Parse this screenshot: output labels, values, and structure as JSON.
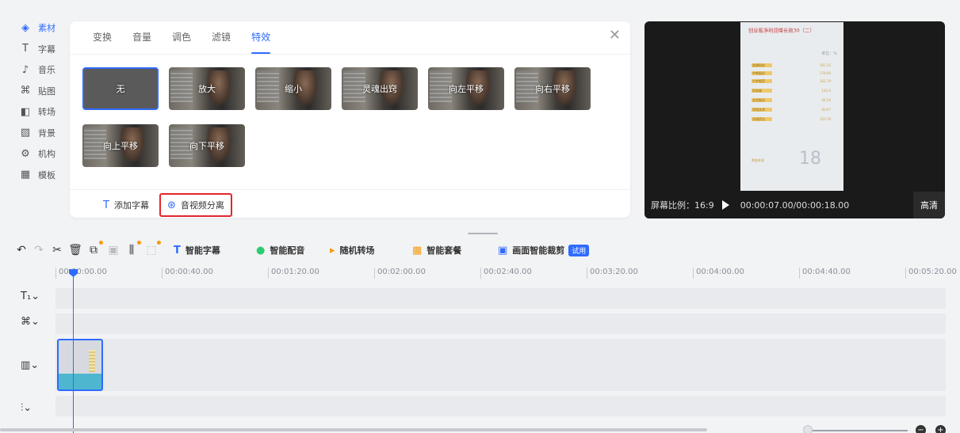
{
  "nav": [
    {
      "icon": "layers-icon",
      "glyph": "◈",
      "label": "素材",
      "active": true
    },
    {
      "icon": "text-icon",
      "glyph": "T",
      "label": "字幕"
    },
    {
      "icon": "music-icon",
      "glyph": "♪",
      "label": "音乐"
    },
    {
      "icon": "sticker-icon",
      "glyph": "⌘",
      "label": "贴图"
    },
    {
      "icon": "transition-icon",
      "glyph": "◧",
      "label": "转场"
    },
    {
      "icon": "background-icon",
      "glyph": "▨",
      "label": "背景"
    },
    {
      "icon": "institution-icon",
      "glyph": "⚙",
      "label": "机构"
    },
    {
      "icon": "template-icon",
      "glyph": "▦",
      "label": "模板"
    }
  ],
  "panel": {
    "tabs": [
      "变换",
      "音量",
      "调色",
      "滤镜",
      "特效"
    ],
    "active_tab": "特效",
    "close": "✕",
    "effects": [
      "无",
      "放大",
      "缩小",
      "灵魂出窍",
      "向左平移",
      "向右平移",
      "向上平移",
      "向下平移"
    ],
    "footer": {
      "add_subtitle": "添加字幕",
      "av_separate": "音视频分离"
    }
  },
  "preview": {
    "doc": {
      "title": "创业板净利润增长前30（二）",
      "unit": "单位：%",
      "big_number": "18",
      "rows": [
        {
          "k": "浪潮科技",
          "v": "181.35"
        },
        {
          "k": "中铁股份",
          "v": "178.66"
        },
        {
          "k": "兴齐眼药",
          "v": "162.79"
        },
        {
          "k": "同花顺",
          "v": "142.6"
        },
        {
          "k": "全信股份",
          "v": "94.29"
        },
        {
          "k": "华钰技术",
          "v": "83.67"
        },
        {
          "k": "光线药业",
          "v": "120.78"
        }
      ],
      "footnote": "数据来源"
    },
    "ratio": "屏幕比例：16:9",
    "time": "00:00:07.00/00:00:18.00",
    "quality": "高清"
  },
  "toolbar": {
    "smart_subtitle": "智能字幕",
    "smart_voice": "智能配音",
    "random_transition": "随机转场",
    "smart_package": "智能套餐",
    "smart_crop": "画面智能裁剪",
    "trial": "试用"
  },
  "ruler": [
    "00:00:00.00",
    "00:00:40.00",
    "00:01:20.00",
    "00:02:00.00",
    "00:02:40.00",
    "00:03:20.00",
    "00:04:00.00",
    "00:04:40.00",
    "00:05:20.00"
  ],
  "zoom": {
    "minus": "−",
    "plus": "+"
  }
}
